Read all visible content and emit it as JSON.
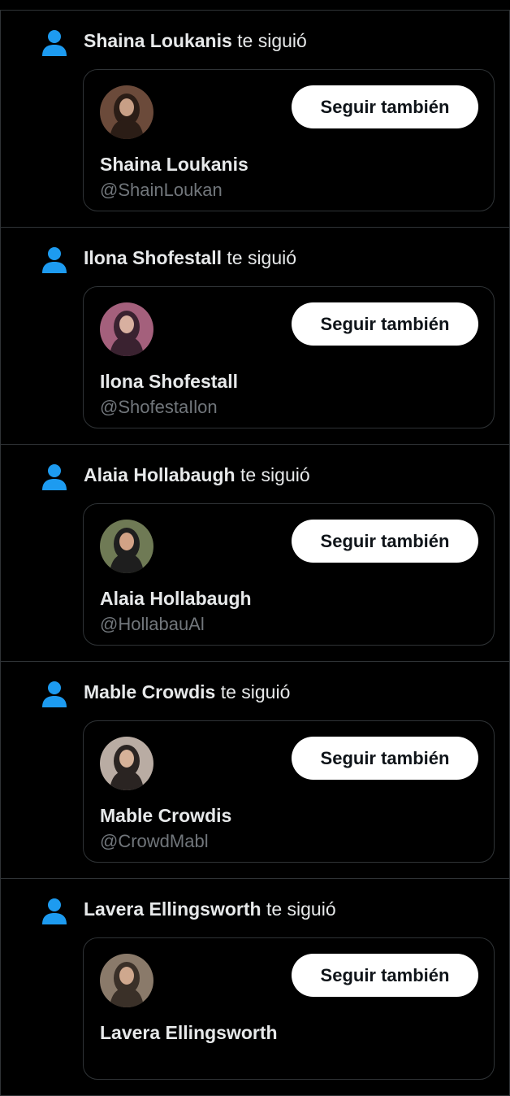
{
  "accent_color": "#1d9bf0",
  "verb": "te siguió",
  "follow_label": "Seguir también",
  "notifications": [
    {
      "name": "Shaina Loukanis",
      "handle": "@ShainLoukan",
      "avatar_colors": [
        "#6b4a3a",
        "#2b1d16",
        "#c89f86"
      ]
    },
    {
      "name": "Ilona Shofestall",
      "handle": "@ShofestaIlon",
      "avatar_colors": [
        "#a4607c",
        "#3a2230",
        "#d8b0a0"
      ]
    },
    {
      "name": "Alaia Hollabaugh",
      "handle": "@HollabauAl",
      "avatar_colors": [
        "#6f7a55",
        "#1e1e1e",
        "#d2a286"
      ]
    },
    {
      "name": "Mable Crowdis",
      "handle": "@CrowdMabl",
      "avatar_colors": [
        "#b9aca3",
        "#2a2422",
        "#d6b299"
      ]
    },
    {
      "name": "Lavera Ellingsworth",
      "handle": "",
      "avatar_colors": [
        "#8a7a6a",
        "#3a3028",
        "#cfa88e"
      ]
    }
  ]
}
